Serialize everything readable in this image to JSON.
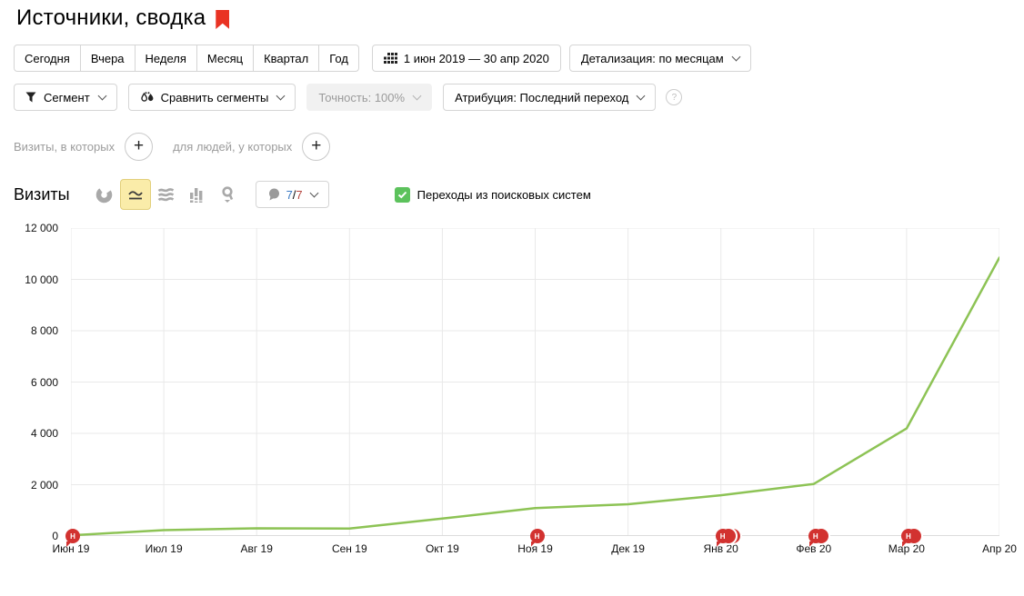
{
  "page": {
    "title": "Источники, сводка"
  },
  "toolbar": {
    "period_buttons": [
      "Сегодня",
      "Вчера",
      "Неделя",
      "Месяц",
      "Квартал",
      "Год"
    ],
    "date_range": "1 июн 2019 — 30 апр 2020",
    "detail_label": "Детализация: по месяцам"
  },
  "segment_bar": {
    "segment_label": "Сегмент",
    "compare_label": "Сравнить сегменты",
    "accuracy_label": "Точность: 100%",
    "attribution_label": "Атрибуция: Последний переход",
    "help_icon": "?"
  },
  "filter_bar": {
    "visits_label": "Визиты, в которых",
    "people_label": "для людей, у которых",
    "plus_icon": "+"
  },
  "metric_bar": {
    "metric_label": "Визиты",
    "chart_type_icons": [
      "pie-chart-icon",
      "line-chart-icon",
      "stacked-area-icon",
      "bar-chart-icon",
      "geo-map-icon"
    ],
    "selected_chart_type": "line-chart-icon",
    "goals_current": "7",
    "goals_separator": "/",
    "goals_total": "7",
    "legend_label": "Переходы из поисковых систем"
  },
  "colors": {
    "line_green": "#8dc355",
    "checkbox_green": "#5cc25c",
    "marker_red": "#d23230",
    "bookmark_red": "#e93323",
    "selected_tool_bg": "#faeca9",
    "grid_gray": "#e9e9e9"
  },
  "chart_data": {
    "type": "line",
    "title": "Визиты",
    "x": [
      "Июн 19",
      "Июл 19",
      "Авг 19",
      "Сен 19",
      "Окт 19",
      "Ноя 19",
      "Дек 19",
      "Янв 20",
      "Фев 20",
      "Мар 20",
      "Апр 20"
    ],
    "series": [
      {
        "name": "Переходы из поисковых систем",
        "color": "#8dc355",
        "values": [
          30,
          230,
          300,
          290,
          680,
          1090,
          1240,
          1590,
          2030,
          4190,
          10850
        ]
      }
    ],
    "ylim": [
      0,
      12000
    ],
    "ytick_labels": [
      "0",
      "2 000",
      "4 000",
      "6 000",
      "8 000",
      "10 000",
      "12 000"
    ],
    "grid": true,
    "legend_position": "above-chart",
    "annotations": [
      {
        "x": "Июн 19",
        "label": "Н",
        "count": 1
      },
      {
        "x": "Ноя 19",
        "label": "Н",
        "count": 1
      },
      {
        "x": "Янв 20",
        "label": "Н",
        "count": 3
      },
      {
        "x": "Фев 20",
        "label": "Н",
        "count": 2
      },
      {
        "x": "Мар 20",
        "label": "Н",
        "count": 2
      }
    ]
  }
}
